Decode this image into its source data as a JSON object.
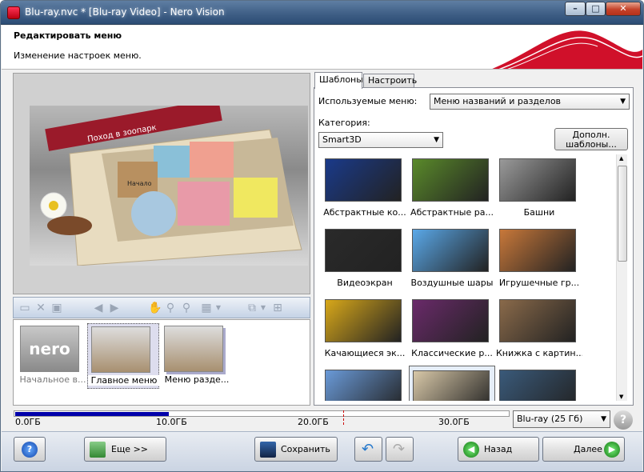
{
  "window": {
    "title": "Blu-ray.nvc * [Blu-ray Video] - Nero Vision",
    "min_label": "–",
    "max_label": "□",
    "close_label": "✕"
  },
  "header": {
    "title": "Редактировать меню",
    "subtitle": "Изменение настроек меню."
  },
  "preview": {
    "banner_text": "Поход в зоопарк",
    "book_label": "Начало"
  },
  "thumbnails": [
    {
      "label": "Начальное в...",
      "selected": false
    },
    {
      "label": "Главное меню",
      "selected": true
    },
    {
      "label": "Меню разде...",
      "selected": false
    }
  ],
  "tabs": [
    {
      "label": "Шаблоны"
    },
    {
      "label": "Настроить"
    }
  ],
  "templates": {
    "used_menus_label": "Используемые меню:",
    "used_menus_value": "Меню названий и разделов",
    "category_label": "Категория:",
    "category_value": "Smart3D",
    "extra_button": "Дополн. шаблоны...",
    "items": [
      {
        "label": "Абстрактные ко...",
        "color": "#1a3a8a"
      },
      {
        "label": "Абстрактные ра...",
        "color": "#5a8a2a"
      },
      {
        "label": "Башни",
        "color": "#9a9a9a"
      },
      {
        "label": "Видеоэкран",
        "color": "#2a2a2a"
      },
      {
        "label": "Воздушные шары",
        "color": "#5aa8e8"
      },
      {
        "label": "Игрушечные гр...",
        "color": "#c8783a"
      },
      {
        "label": "Качающиеся эк...",
        "color": "#d8a81a"
      },
      {
        "label": "Классические р...",
        "color": "#6a2a6a"
      },
      {
        "label": "Книжка с картин...",
        "color": "#8a6a4a"
      },
      {
        "label": "",
        "color": "#6a9ad8"
      },
      {
        "label": "",
        "color": "#d8c8a8"
      },
      {
        "label": "",
        "color": "#3a5a7a"
      }
    ]
  },
  "capacity": {
    "ticks": [
      "0.0ГБ",
      "10.0ГБ",
      "20.0ГБ",
      "30.0ГБ"
    ],
    "used_fraction": 0.31,
    "disc_value": "Blu-ray (25 Гб)"
  },
  "footer": {
    "help": "?",
    "more": "Еще >>",
    "save": "Сохранить",
    "back": "Назад",
    "next": "Далее"
  }
}
